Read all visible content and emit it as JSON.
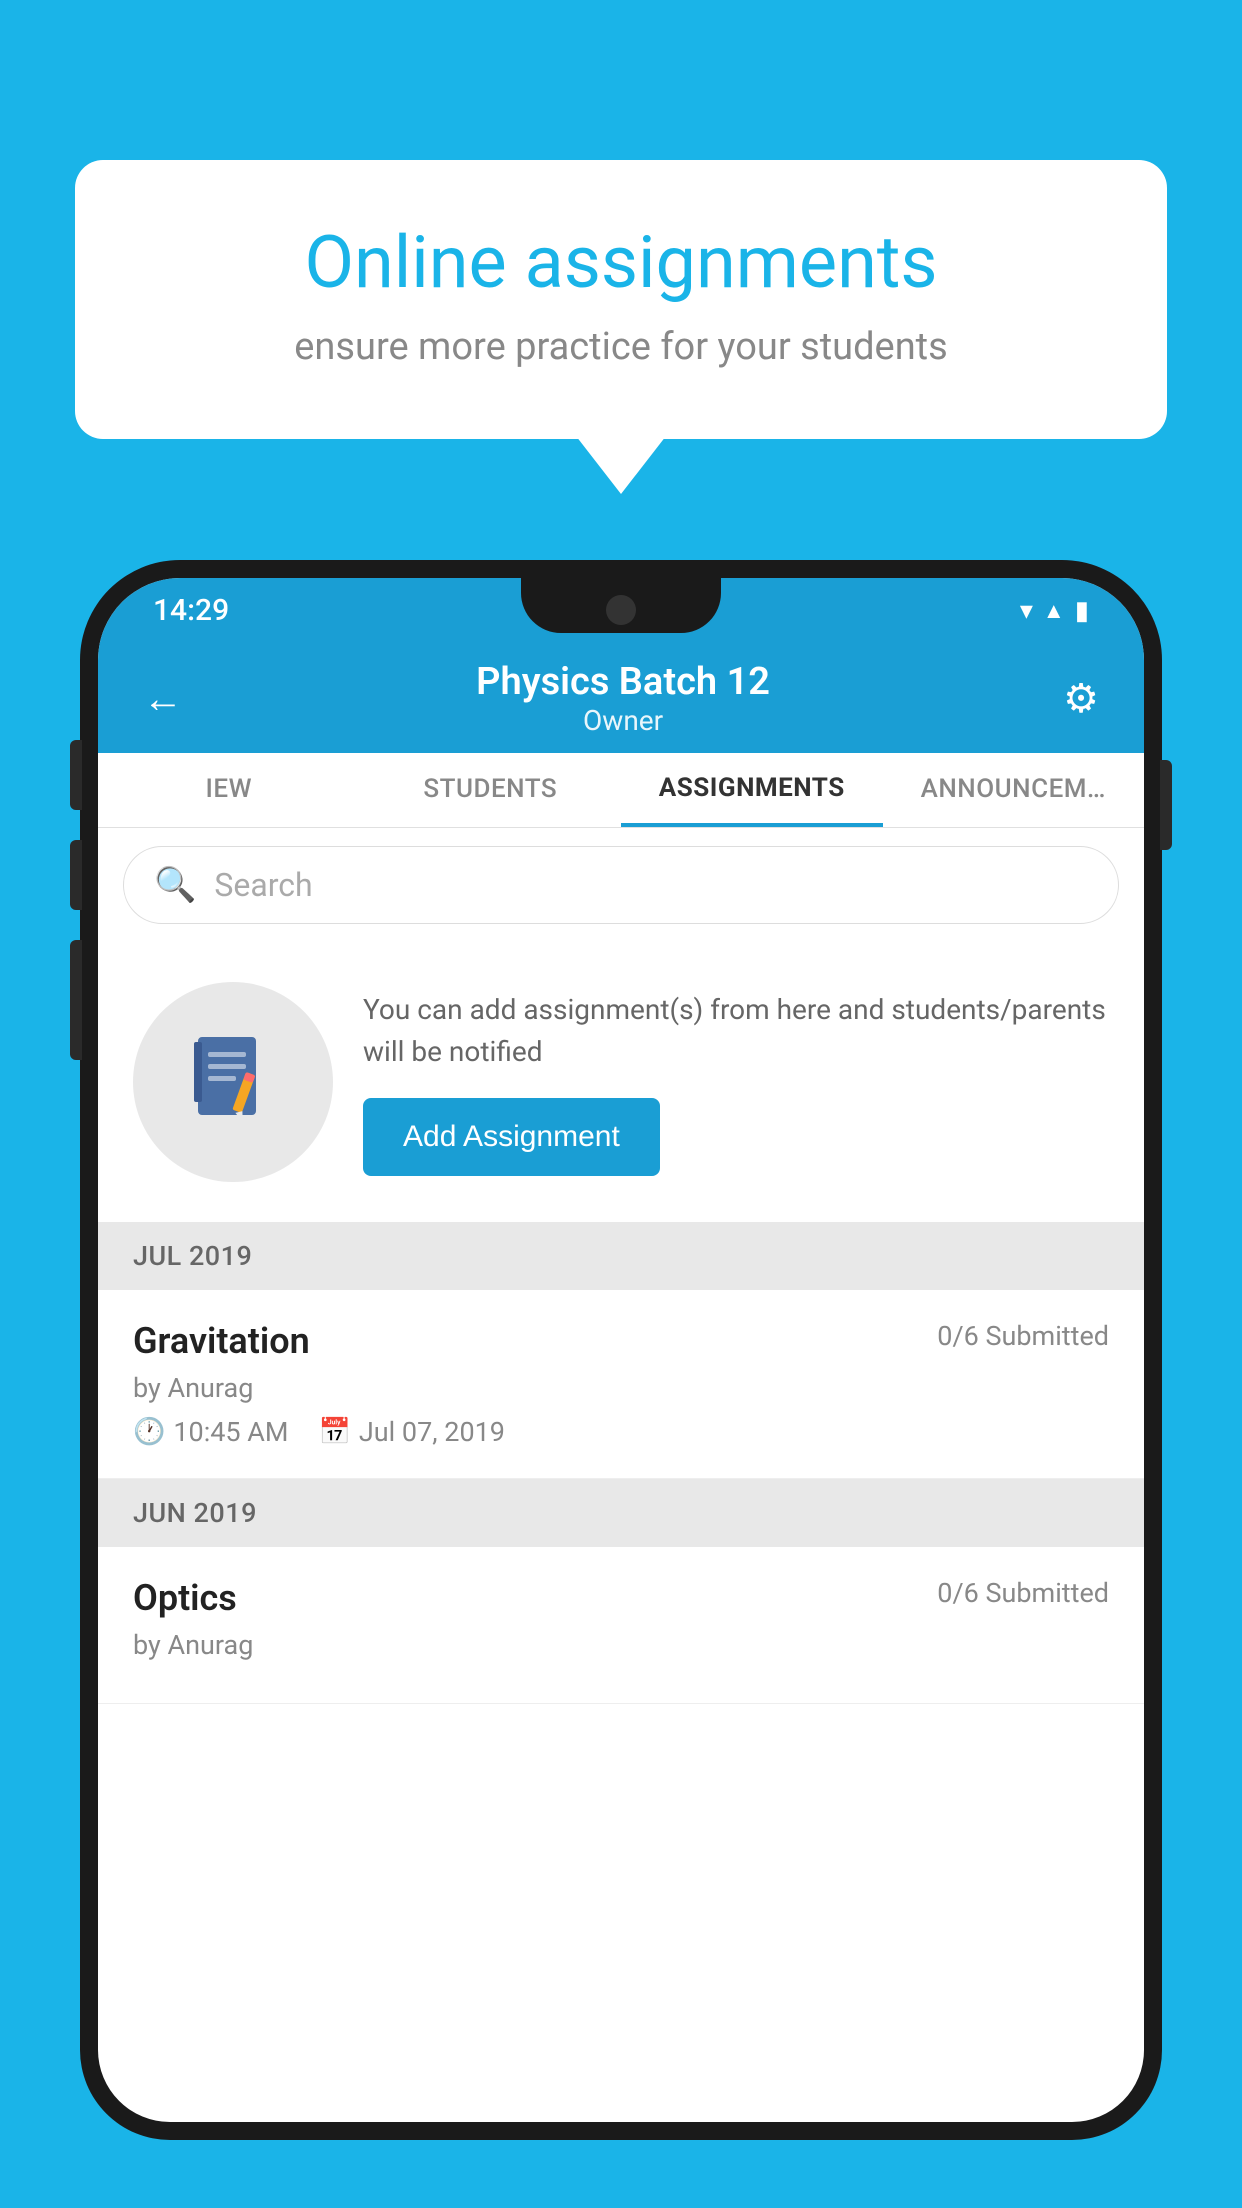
{
  "background_color": "#1ab4e8",
  "speech_bubble": {
    "title": "Online assignments",
    "subtitle": "ensure more practice for your students"
  },
  "status_bar": {
    "time": "14:29",
    "icons": [
      "wifi",
      "signal",
      "battery"
    ]
  },
  "app_bar": {
    "title": "Physics Batch 12",
    "subtitle": "Owner",
    "back_label": "←"
  },
  "tabs": [
    {
      "label": "IEW",
      "active": false
    },
    {
      "label": "STUDENTS",
      "active": false
    },
    {
      "label": "ASSIGNMENTS",
      "active": true
    },
    {
      "label": "ANNOUNCEM…",
      "active": false
    }
  ],
  "search": {
    "placeholder": "Search"
  },
  "promo": {
    "description": "You can add assignment(s) from here and students/parents will be notified",
    "button_label": "Add Assignment"
  },
  "sections": [
    {
      "header": "JUL 2019",
      "assignments": [
        {
          "name": "Gravitation",
          "submitted": "0/6 Submitted",
          "by": "by Anurag",
          "time": "10:45 AM",
          "date": "Jul 07, 2019"
        }
      ]
    },
    {
      "header": "JUN 2019",
      "assignments": [
        {
          "name": "Optics",
          "submitted": "0/6 Submitted",
          "by": "by Anurag",
          "time": "",
          "date": ""
        }
      ]
    }
  ]
}
